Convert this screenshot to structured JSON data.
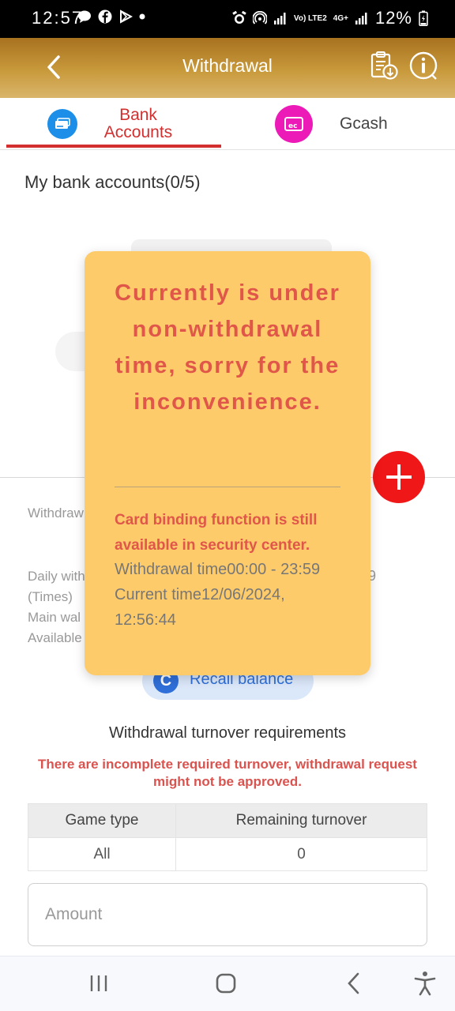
{
  "status_bar": {
    "time": "12:57",
    "battery_percent": "12%",
    "network_labels": [
      "Vo) LTE2",
      "4G+"
    ],
    "icons": [
      "chat-bubble-icon",
      "facebook-icon",
      "play-store-icon",
      "dot-icon",
      "alarm-icon",
      "hotspot-icon",
      "signal-icon",
      "signal-icon",
      "battery-charging-icon"
    ]
  },
  "header": {
    "title": "Withdrawal",
    "icons": [
      "back-arrow-icon",
      "clipboard-download-icon",
      "info-circle-icon"
    ]
  },
  "tabs": [
    {
      "label": "Bank Accounts",
      "active": true,
      "icon": "bank-card-icon",
      "color": "#1e8fe8"
    },
    {
      "label": "Gcash",
      "active": false,
      "icon": "wallet-icon",
      "color": "#ec1bb7"
    }
  ],
  "section": {
    "title": "My bank accounts(0/5)"
  },
  "background_texts": {
    "withdraw_partial": "Withdraw",
    "daily_with_partial": "Daily with",
    "times": "(Times)",
    "main_wal_partial": "Main wal",
    "available_partial": "Available",
    "nine_partial": "9"
  },
  "recall_button": {
    "label": "Recall balance",
    "icon_letter": "C"
  },
  "turnover": {
    "title": "Withdrawal turnover requirements",
    "warning": "There are incomplete required turnover, withdrawal request might not be approved.",
    "columns": [
      "Game type",
      "Remaining turnover"
    ],
    "rows": [
      [
        "All",
        "0"
      ]
    ]
  },
  "amount_input": {
    "placeholder": "Amount",
    "value": ""
  },
  "modal": {
    "headline": "Currently is under non-withdrawal time, sorry for the inconvenience.",
    "note": "Card binding function is still available in security center.",
    "withdrawal_time": "Withdrawal time00:00 - 23:59",
    "current_time": "Current time12/06/2024, 12:56:44"
  },
  "colors": {
    "accent_red": "#d32f2f",
    "modal_bg": "#fecb6b",
    "modal_text": "#e0574a",
    "header_gold": "#b88330",
    "add_button": "#ef1717"
  }
}
